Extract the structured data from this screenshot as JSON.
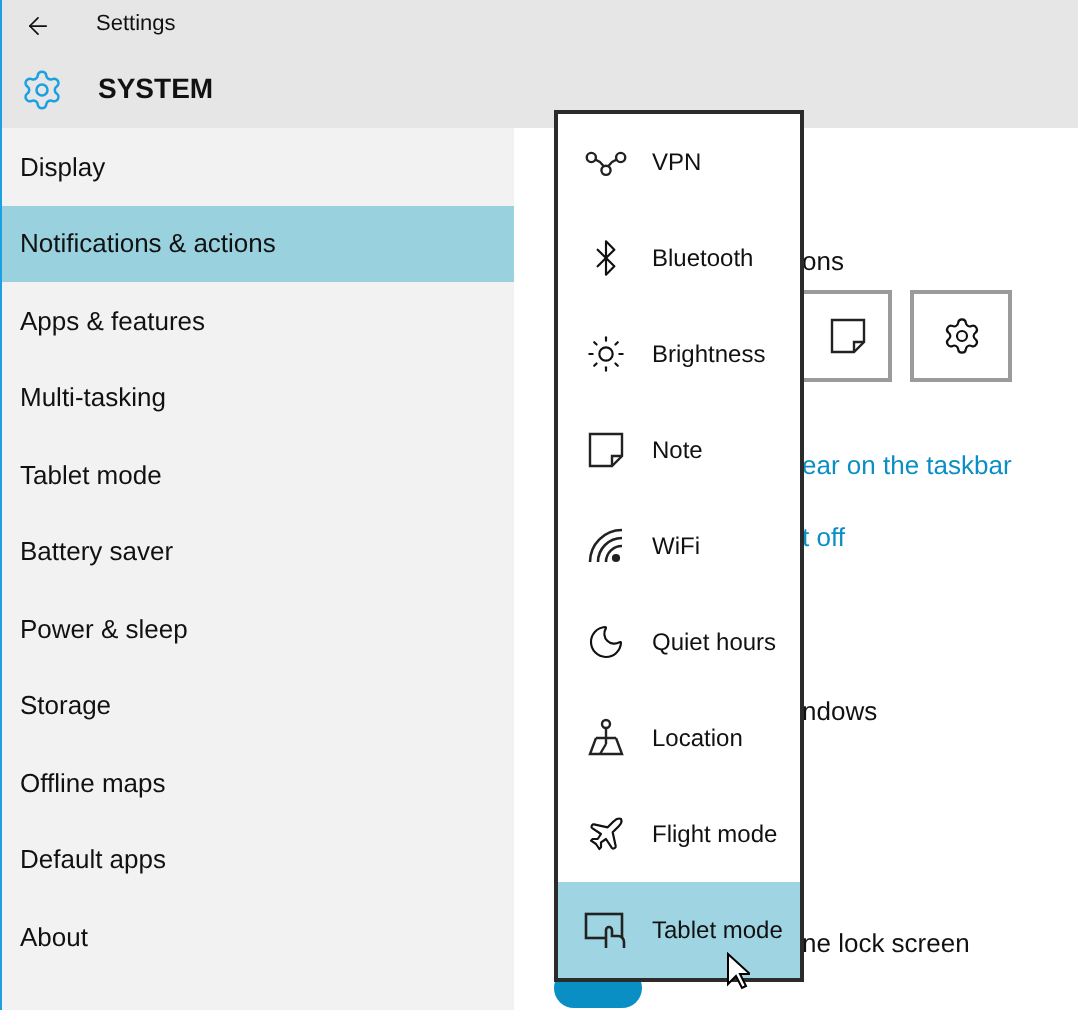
{
  "window": {
    "title": "Settings"
  },
  "header": {
    "title": "SYSTEM"
  },
  "sidebar": {
    "items": [
      {
        "label": "Display",
        "selected": false
      },
      {
        "label": "Notifications & actions",
        "selected": true
      },
      {
        "label": "Apps & features",
        "selected": false
      },
      {
        "label": "Multi-tasking",
        "selected": false
      },
      {
        "label": "Tablet mode",
        "selected": false
      },
      {
        "label": "Battery saver",
        "selected": false
      },
      {
        "label": "Power & sleep",
        "selected": false
      },
      {
        "label": "Storage",
        "selected": false
      },
      {
        "label": "Offline maps",
        "selected": false
      },
      {
        "label": "Default apps",
        "selected": false
      },
      {
        "label": "About",
        "selected": false
      }
    ]
  },
  "content": {
    "heading_fragment": "ons",
    "link_1": "ear on the taskbar",
    "link_2": "t off",
    "text_1": "ndows",
    "text_2": "ne lock screen",
    "toggle": {
      "on": true
    }
  },
  "quick_action_menu": {
    "items": [
      {
        "label": "VPN",
        "selected": false
      },
      {
        "label": "Bluetooth",
        "selected": false
      },
      {
        "label": "Brightness",
        "selected": false
      },
      {
        "label": "Note",
        "selected": false
      },
      {
        "label": "WiFi",
        "selected": false
      },
      {
        "label": "Quiet hours",
        "selected": false
      },
      {
        "label": "Location",
        "selected": false
      },
      {
        "label": "Flight mode",
        "selected": false
      },
      {
        "label": "Tablet mode",
        "selected": true
      }
    ]
  }
}
